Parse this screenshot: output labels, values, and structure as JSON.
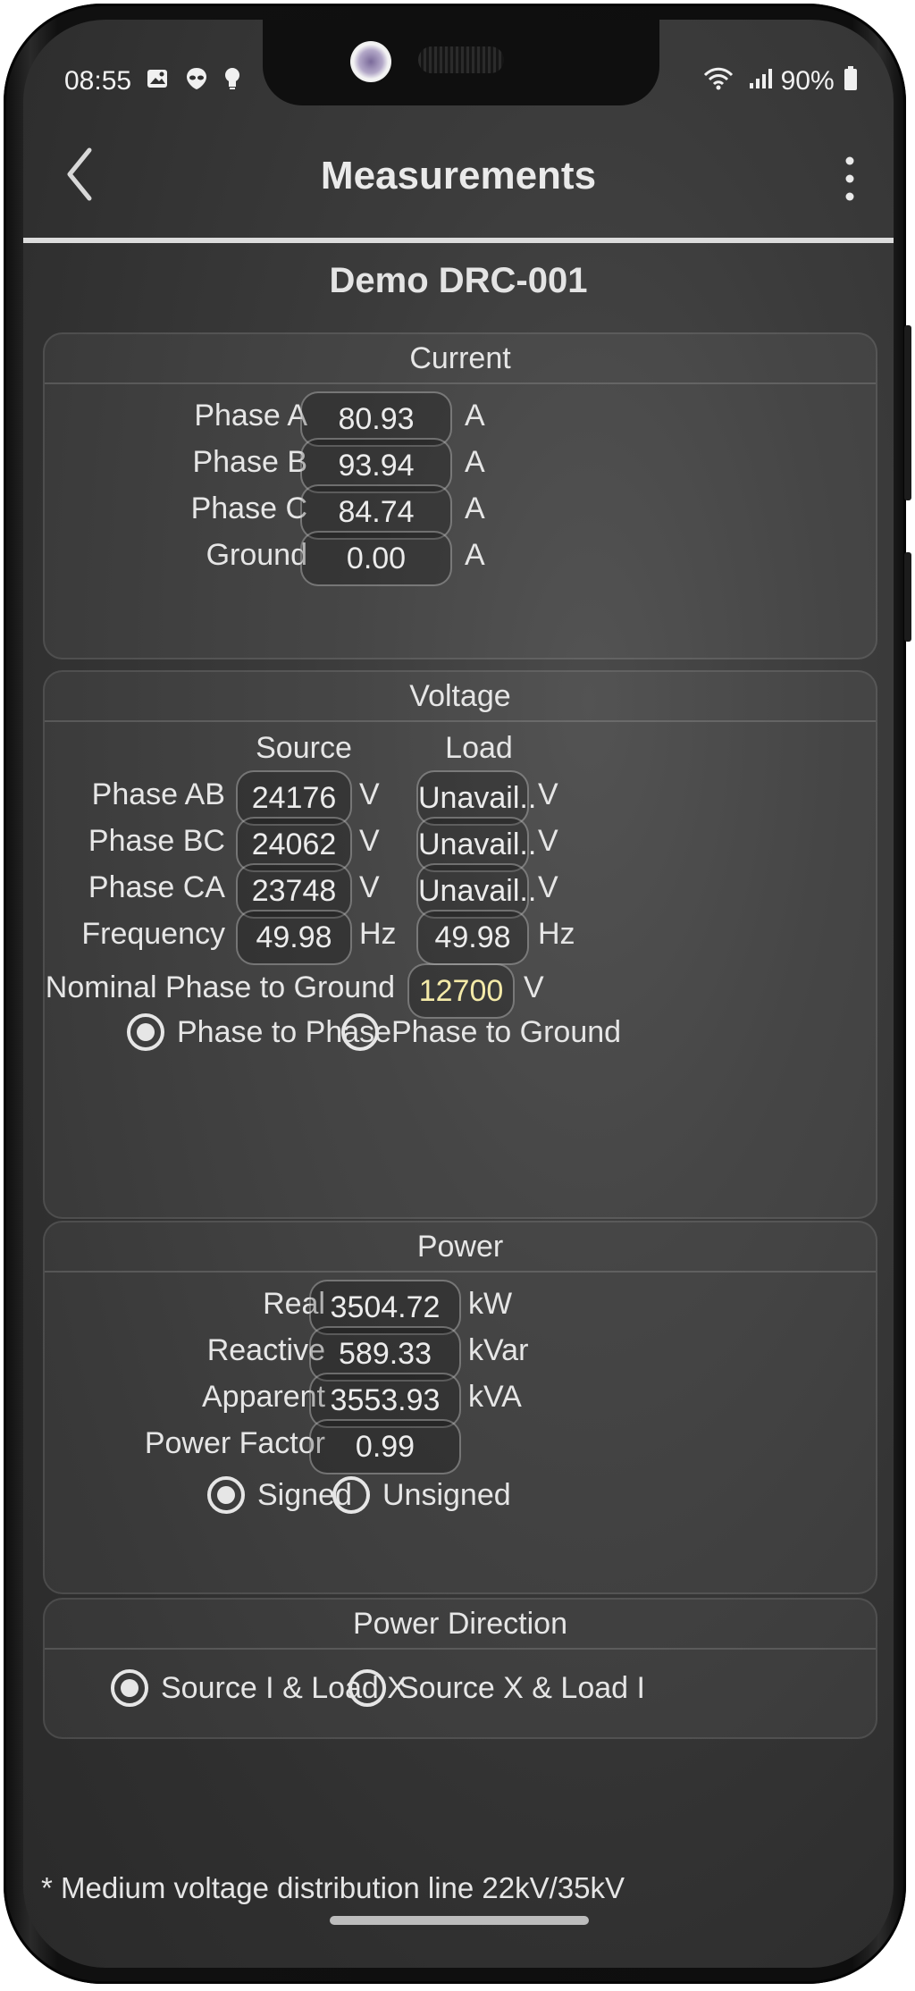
{
  "status_bar": {
    "time": "08:55",
    "battery": "90%",
    "left_icons": [
      "image-icon",
      "alien-icon",
      "lightbulb-icon"
    ],
    "right_icons": [
      "wifi-icon",
      "signal-icon",
      "battery-icon"
    ]
  },
  "app_bar": {
    "title": "Measurements",
    "back_icon": "chevron-left-icon",
    "menu_icon": "more-vertical-icon"
  },
  "device_name": "Demo DRC-001",
  "current": {
    "title": "Current",
    "rows": [
      {
        "label": "Phase A",
        "value": "80.93",
        "unit": "A"
      },
      {
        "label": "Phase B",
        "value": "93.94",
        "unit": "A"
      },
      {
        "label": "Phase C",
        "value": "84.74",
        "unit": "A"
      },
      {
        "label": "Ground",
        "value": "0.00",
        "unit": "A"
      }
    ]
  },
  "voltage": {
    "title": "Voltage",
    "source_header": "Source",
    "load_header": "Load",
    "rows": [
      {
        "label": "Phase AB",
        "source": "24176",
        "source_unit": "V",
        "load": "Unavail..",
        "load_unit": "V"
      },
      {
        "label": "Phase BC",
        "source": "24062",
        "source_unit": "V",
        "load": "Unavail..",
        "load_unit": "V"
      },
      {
        "label": "Phase CA",
        "source": "23748",
        "source_unit": "V",
        "load": "Unavail..",
        "load_unit": "V"
      },
      {
        "label": "Frequency",
        "source": "49.98",
        "source_unit": "Hz",
        "load": "49.98",
        "load_unit": "Hz"
      }
    ],
    "nominal_label": "Nominal Phase to Ground",
    "nominal_value": "12700",
    "nominal_unit": "V",
    "mode_options": [
      "Phase to Phase",
      "Phase to Ground"
    ],
    "mode_selected": "Phase to Phase"
  },
  "power": {
    "title": "Power",
    "rows": [
      {
        "label": "Real",
        "value": "3504.72",
        "unit": "kW"
      },
      {
        "label": "Reactive",
        "value": "589.33",
        "unit": "kVar"
      },
      {
        "label": "Apparent",
        "value": "3553.93",
        "unit": "kVA"
      },
      {
        "label": "Power Factor",
        "value": "0.99",
        "unit": ""
      }
    ],
    "sign_options": [
      "Signed",
      "Unsigned"
    ],
    "sign_selected": "Signed"
  },
  "power_direction": {
    "title": "Power Direction",
    "options": [
      "Source I & Load X",
      "Source X & Load I"
    ],
    "selected": "Source I & Load X"
  },
  "footnote": "* Medium voltage distribution line 22kV/35kV",
  "colors": {
    "screen_bg": "#3a3a3a",
    "text": "#e6e6e6",
    "nominal_value": "#f4eaa8"
  }
}
